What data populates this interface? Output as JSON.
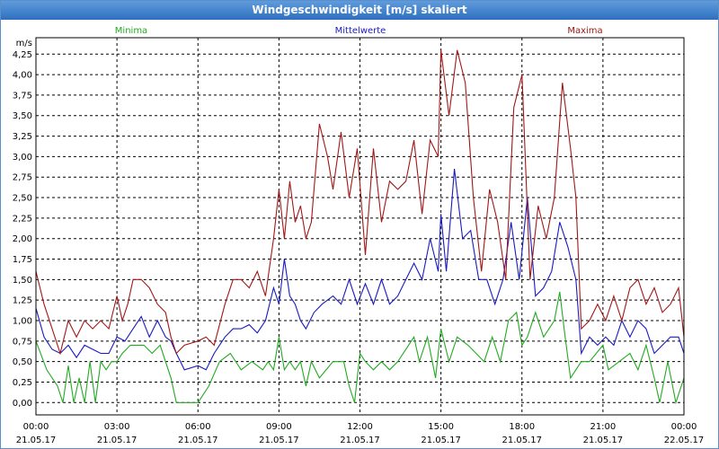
{
  "window_title": "Windgeschwindigkeit [m/s] skaliert",
  "colors": {
    "minima": "#22aa22",
    "mittelwerte": "#1a1ac0",
    "maxima": "#a01818"
  },
  "chart_data": {
    "type": "line",
    "unit_label": "m/s",
    "ylim": [
      -0.15,
      4.45
    ],
    "y_ticks": [
      "0,00",
      "0,25",
      "0,50",
      "0,75",
      "1,00",
      "1,25",
      "1,50",
      "1,75",
      "2,00",
      "2,25",
      "2,50",
      "2,75",
      "3,00",
      "3,25",
      "3,50",
      "3,75",
      "4,00",
      "4,25"
    ],
    "x_range_hours": [
      0,
      24
    ],
    "x_ticks": [
      {
        "time": "00:00",
        "date": "21.05.17"
      },
      {
        "time": "03:00",
        "date": "21.05.17"
      },
      {
        "time": "06:00",
        "date": "21.05.17"
      },
      {
        "time": "09:00",
        "date": "21.05.17"
      },
      {
        "time": "12:00",
        "date": "21.05.17"
      },
      {
        "time": "15:00",
        "date": "21.05.17"
      },
      {
        "time": "18:00",
        "date": "21.05.17"
      },
      {
        "time": "21:00",
        "date": "21.05.17"
      },
      {
        "time": "00:00",
        "date": "22.05.17"
      }
    ],
    "grid": true,
    "series": [
      {
        "name": "Minima",
        "x": [
          0,
          0.4,
          0.8,
          1,
          1.2,
          1.4,
          1.6,
          1.8,
          2,
          2.2,
          2.4,
          2.6,
          2.8,
          3,
          3.2,
          3.5,
          4,
          4.3,
          4.6,
          5,
          5.2,
          5.4,
          6,
          6.4,
          6.8,
          7.2,
          7.6,
          8,
          8.4,
          8.6,
          8.8,
          9,
          9.2,
          9.4,
          9.6,
          9.8,
          10,
          10.2,
          10.5,
          11,
          11.4,
          11.6,
          11.8,
          12,
          12.2,
          12.5,
          12.8,
          13.1,
          13.4,
          13.8,
          14,
          14.2,
          14.5,
          14.8,
          15,
          15.3,
          15.6,
          16,
          16.3,
          16.6,
          16.9,
          17.2,
          17.5,
          17.8,
          18,
          18.2,
          18.5,
          18.8,
          19.2,
          19.4,
          19.6,
          19.8,
          20,
          20.2,
          20.5,
          21,
          21.2,
          21.6,
          22,
          22.3,
          22.6,
          22.9,
          23.1,
          23.4,
          23.7,
          24
        ],
        "values": [
          0.75,
          0.4,
          0.2,
          0,
          0.45,
          0,
          0.3,
          0,
          0.5,
          0,
          0.5,
          0.4,
          0.5,
          0.5,
          0.6,
          0.7,
          0.7,
          0.6,
          0.7,
          0.3,
          0,
          0,
          0,
          0.2,
          0.5,
          0.6,
          0.4,
          0.5,
          0.4,
          0.5,
          0.4,
          0.8,
          0.4,
          0.5,
          0.4,
          0.5,
          0.2,
          0.5,
          0.3,
          0.5,
          0.5,
          0.2,
          0,
          0.6,
          0.5,
          0.4,
          0.5,
          0.4,
          0.5,
          0.7,
          0.8,
          0.5,
          0.8,
          0.3,
          0.9,
          0.5,
          0.8,
          0.7,
          0.6,
          0.5,
          0.8,
          0.5,
          1.0,
          1.1,
          0.7,
          0.8,
          1.1,
          0.8,
          1.0,
          1.35,
          0.8,
          0.3,
          0.4,
          0.5,
          0.5,
          0.7,
          0.4,
          0.5,
          0.6,
          0.4,
          0.7,
          0.3,
          0.0,
          0.5,
          0.0,
          0.3
        ]
      },
      {
        "name": "Mittelwerte",
        "x": [
          0,
          0.3,
          0.6,
          0.9,
          1.2,
          1.5,
          1.8,
          2.1,
          2.4,
          2.7,
          3,
          3.3,
          3.6,
          3.9,
          4.2,
          4.5,
          4.8,
          5,
          5.2,
          5.5,
          6,
          6.3,
          6.6,
          7,
          7.3,
          7.6,
          7.9,
          8.2,
          8.5,
          8.8,
          9,
          9.2,
          9.4,
          9.6,
          9.8,
          10,
          10.3,
          10.6,
          11,
          11.3,
          11.6,
          11.9,
          12.2,
          12.5,
          12.8,
          13.1,
          13.4,
          13.7,
          14,
          14.3,
          14.6,
          14.9,
          15,
          15.2,
          15.5,
          15.8,
          16.1,
          16.4,
          16.7,
          17,
          17.3,
          17.6,
          17.9,
          18.2,
          18.5,
          18.8,
          19.1,
          19.4,
          19.7,
          20,
          20.2,
          20.5,
          20.8,
          21.1,
          21.4,
          21.7,
          22,
          22.3,
          22.6,
          22.9,
          23.2,
          23.5,
          23.8,
          24
        ],
        "values": [
          1.15,
          0.8,
          0.65,
          0.6,
          0.7,
          0.55,
          0.7,
          0.65,
          0.6,
          0.6,
          0.8,
          0.75,
          0.9,
          1.05,
          0.8,
          1.0,
          0.8,
          0.75,
          0.6,
          0.4,
          0.45,
          0.4,
          0.6,
          0.8,
          0.9,
          0.9,
          0.95,
          0.85,
          1.0,
          1.4,
          1.2,
          1.75,
          1.3,
          1.2,
          1.0,
          0.9,
          1.1,
          1.2,
          1.3,
          1.2,
          1.5,
          1.2,
          1.45,
          1.2,
          1.5,
          1.2,
          1.3,
          1.5,
          1.7,
          1.5,
          2.0,
          1.6,
          2.3,
          1.6,
          2.85,
          2.0,
          2.1,
          1.5,
          1.5,
          1.2,
          1.5,
          2.2,
          1.5,
          2.5,
          1.3,
          1.4,
          1.6,
          2.2,
          1.9,
          1.5,
          0.6,
          0.8,
          0.7,
          0.8,
          0.7,
          1.0,
          0.8,
          1.0,
          0.9,
          0.6,
          0.7,
          0.8,
          0.8,
          0.6
        ]
      },
      {
        "name": "Maxima",
        "x": [
          0,
          0.3,
          0.6,
          0.9,
          1.2,
          1.5,
          1.8,
          2.1,
          2.4,
          2.7,
          3,
          3.2,
          3.4,
          3.6,
          3.9,
          4.2,
          4.5,
          4.8,
          5,
          5.2,
          5.5,
          6,
          6.3,
          6.6,
          7,
          7.3,
          7.6,
          7.9,
          8.2,
          8.5,
          8.8,
          9,
          9.2,
          9.4,
          9.6,
          9.8,
          10,
          10.2,
          10.5,
          10.8,
          11,
          11.3,
          11.6,
          11.9,
          12.2,
          12.5,
          12.8,
          13.1,
          13.4,
          13.7,
          14,
          14.3,
          14.6,
          14.9,
          15,
          15.3,
          15.6,
          15.9,
          16.2,
          16.5,
          16.8,
          17.1,
          17.4,
          17.7,
          18,
          18.3,
          18.6,
          18.9,
          19.2,
          19.5,
          19.8,
          20,
          20.2,
          20.5,
          20.8,
          21.1,
          21.4,
          21.7,
          22,
          22.3,
          22.6,
          22.9,
          23.2,
          23.5,
          23.8,
          24
        ],
        "values": [
          1.6,
          1.2,
          0.9,
          0.6,
          1.0,
          0.8,
          1.0,
          0.9,
          1.0,
          0.9,
          1.3,
          1.0,
          1.2,
          1.5,
          1.5,
          1.4,
          1.2,
          1.1,
          0.8,
          0.6,
          0.7,
          0.75,
          0.8,
          0.7,
          1.2,
          1.5,
          1.5,
          1.4,
          1.6,
          1.3,
          2.0,
          2.6,
          2.0,
          2.7,
          2.2,
          2.4,
          2.0,
          2.2,
          3.4,
          3.0,
          2.6,
          3.3,
          2.5,
          3.1,
          1.8,
          3.1,
          2.2,
          2.7,
          2.6,
          2.7,
          3.2,
          2.3,
          3.2,
          3.0,
          4.3,
          3.5,
          4.3,
          3.9,
          2.5,
          1.6,
          2.6,
          2.2,
          1.5,
          3.6,
          4.0,
          1.5,
          2.4,
          2.0,
          2.5,
          3.9,
          3.1,
          2.5,
          0.9,
          1.0,
          1.2,
          1.0,
          1.3,
          1.0,
          1.4,
          1.5,
          1.2,
          1.4,
          1.1,
          1.2,
          1.4,
          0.8
        ]
      }
    ]
  }
}
